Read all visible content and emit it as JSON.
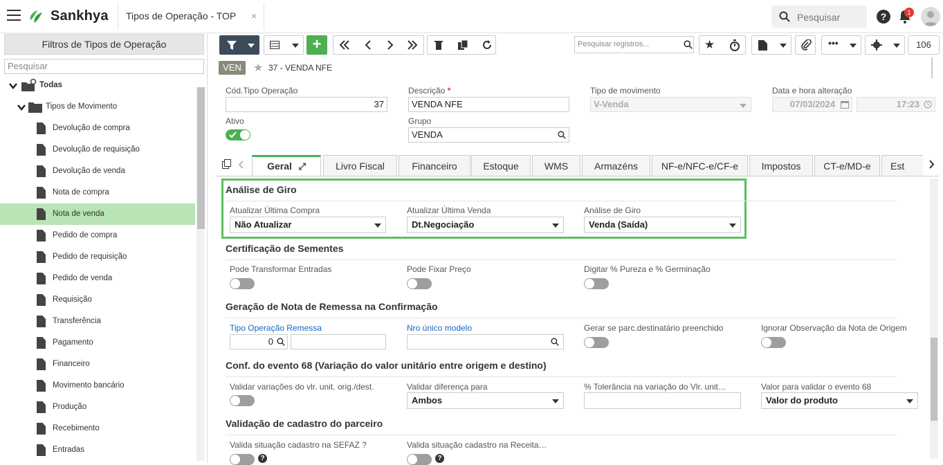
{
  "app": {
    "brand": "Sankhya",
    "tab_title": "Tipos de Operação - TOP",
    "tab_close": "×",
    "search_placeholder": "Pesquisar",
    "help": "?",
    "notifications": "1"
  },
  "sidebar": {
    "title": "Filtros de Tipos de Operação",
    "search_placeholder": "Pesquisar",
    "root": "Todas",
    "group": "Tipos de Movimento",
    "items": [
      {
        "label": "Devolução de compra"
      },
      {
        "label": "Devolução de requisição"
      },
      {
        "label": "Devolução de venda"
      },
      {
        "label": "Nota de compra"
      },
      {
        "label": "Nota de venda",
        "selected": true
      },
      {
        "label": "Pedido de compra"
      },
      {
        "label": "Pedido de requisição"
      },
      {
        "label": "Pedido de venda"
      },
      {
        "label": "Requisição"
      },
      {
        "label": "Transferência"
      },
      {
        "label": "Pagamento"
      },
      {
        "label": "Financeiro"
      },
      {
        "label": "Movimento bancário"
      },
      {
        "label": "Produção"
      },
      {
        "label": "Recebimento"
      },
      {
        "label": "Entradas"
      }
    ]
  },
  "toolbar": {
    "search_placeholder": "Pesquisar registros...",
    "record_count": "106"
  },
  "record": {
    "badge": "VEN",
    "title": "37 - VENDA NFE"
  },
  "form": {
    "cod_label": "Cód.Tipo Operação",
    "cod_value": "37",
    "desc_label": "Descrição",
    "desc_required": "*",
    "desc_value": "VENDA NFE",
    "tipo_mov_label": "Tipo de movimento",
    "tipo_mov_value": "V-Venda",
    "data_label": "Data e hora alteração",
    "data_value": "07/03/2024",
    "hora_value": "17:23",
    "ativo_label": "Ativo",
    "grupo_label": "Grupo",
    "grupo_value": "VENDA"
  },
  "tabs": [
    {
      "label": "Geral"
    },
    {
      "label": "Livro Fiscal"
    },
    {
      "label": "Financeiro"
    },
    {
      "label": "Estoque"
    },
    {
      "label": "WMS"
    },
    {
      "label": "Armazéns"
    },
    {
      "label": "NF-e/NFC-e/CF-e"
    },
    {
      "label": "Impostos"
    },
    {
      "label": "CT-e/MD-e"
    },
    {
      "label": "Est"
    }
  ],
  "sections": {
    "giro": {
      "title": "Análise de Giro",
      "f1_label": "Atualizar Última Compra",
      "f1_value": "Não Atualizar",
      "f2_label": "Atualizar Última Venda",
      "f2_value": "Dt.Negociação",
      "f3_label": "Análise de Giro",
      "f3_value": "Venda (Saída)"
    },
    "sementes": {
      "title": "Certificação de Sementes",
      "f1_label": "Pode Transformar Entradas",
      "f2_label": "Pode Fixar Preço",
      "f3_label": "Digitar % Pureza e % Germinação"
    },
    "remessa": {
      "title": "Geração de Nota de Remessa na Confirmação",
      "f1_label": "Tipo Operação Remessa",
      "f1_value": "0",
      "f2_label": "Nro único modelo",
      "f3_label": "Gerar se parc.destinatário preenchido",
      "f4_label": "Ignorar Observação da Nota de Origem"
    },
    "evento68": {
      "title": "Conf. do evento 68 (Variação do valor unitário entre origem e destino)",
      "f1_label": "Validar variações do vlr. unit. orig./dest.",
      "f2_label": "Validar diferença para",
      "f2_value": "Ambos",
      "f3_label": "% Tolerância na variação do Vlr. unit…",
      "f4_label": "Valor para validar o evento 68",
      "f4_value": "Valor do produto"
    },
    "parceiro": {
      "title": "Validação de cadastro do parceiro",
      "f1_label": "Valida situação cadastro na SEFAZ ?",
      "f2_label": "Valida situação cadastro na Receita…"
    }
  },
  "colors": {
    "accent": "#4caf50",
    "selected_row": "#b9e4b6",
    "toolbar_dark": "#3d4a5a"
  }
}
